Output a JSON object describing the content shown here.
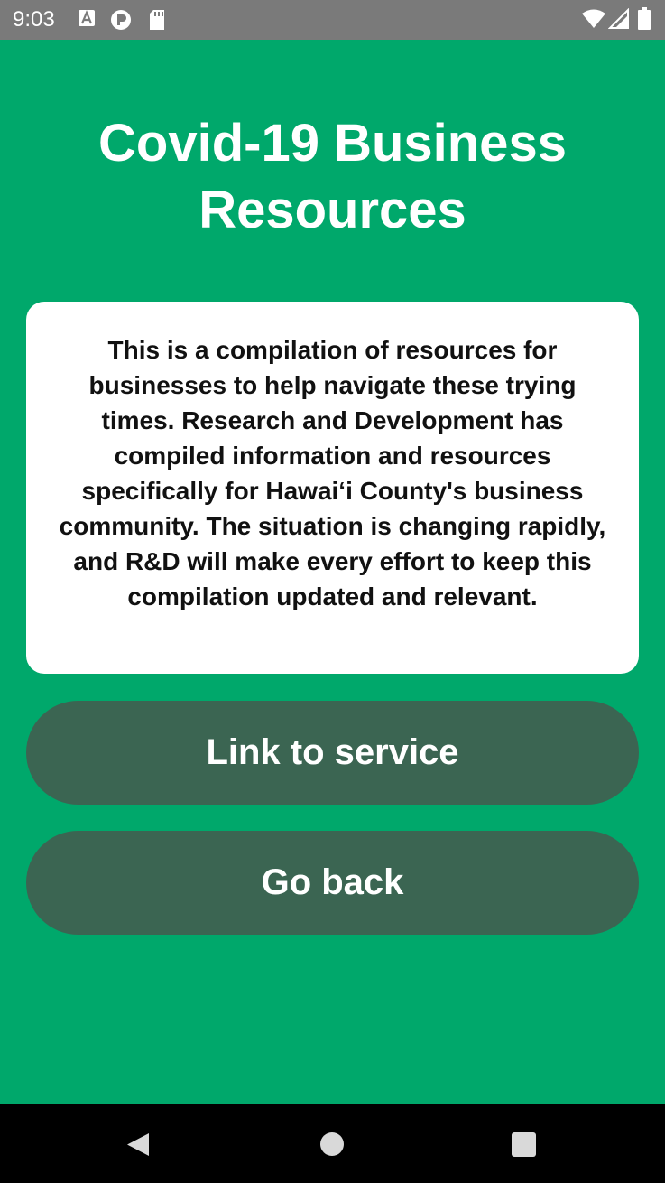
{
  "status_bar": {
    "time": "9:03",
    "left_icons": [
      "font-a-icon",
      "p-badge-icon",
      "sd-card-icon"
    ],
    "right_icons": [
      "wifi-icon",
      "cell-signal-icon",
      "battery-icon"
    ]
  },
  "page": {
    "title": "Covid-19 Business Resources",
    "description": "This is a compilation of resources for businesses to help navigate these trying times.  Research and Development has compiled information and resources specifically for Hawai‘i County's business community. The situation is changing rapidly, and R&D will make every effort to keep this compilation updated and relevant."
  },
  "buttons": {
    "link_label": "Link to service",
    "back_label": "Go back"
  },
  "nav_bar": {
    "icons": [
      "back-triangle-icon",
      "home-circle-icon",
      "recents-square-icon"
    ]
  },
  "colors": {
    "background": "#00A86B",
    "button": "#3B6552",
    "card": "#FFFFFF",
    "status_bar": "#7A7A7A",
    "nav_bar": "#000000"
  }
}
